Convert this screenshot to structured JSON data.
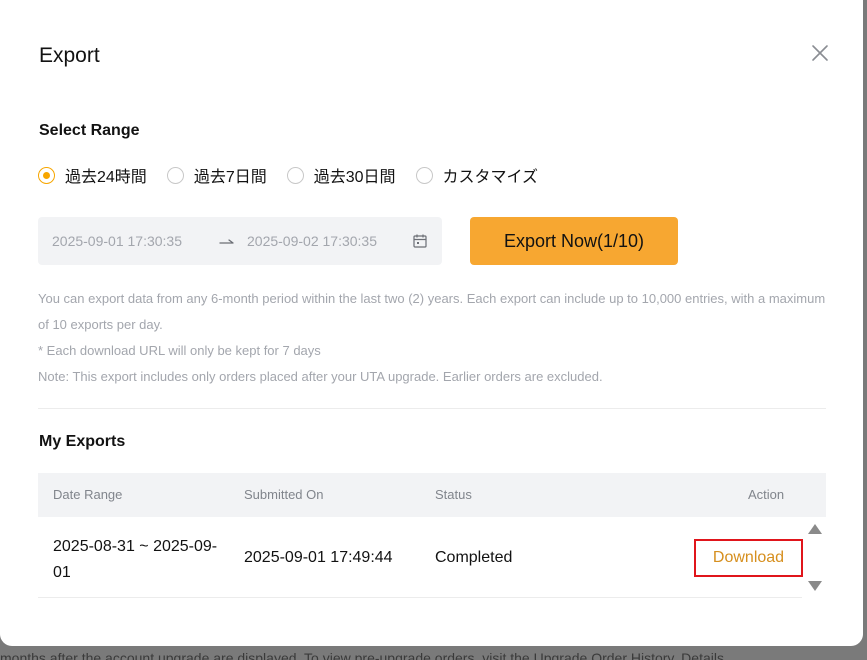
{
  "background_text": "months after the account upgrade are displayed. To view pre-upgrade orders, visit the Upgrade Order History. Details",
  "modal": {
    "title": "Export",
    "close_icon": "close-icon"
  },
  "select_range": {
    "title": "Select Range",
    "options": [
      {
        "label": "過去24時間",
        "checked": true
      },
      {
        "label": "過去7日間",
        "checked": false
      },
      {
        "label": "過去30日間",
        "checked": false
      },
      {
        "label": "カスタマイズ",
        "checked": false
      }
    ],
    "accent_color": "#f7a600"
  },
  "date_range": {
    "start": "2025-09-01 17:30:35",
    "end": "2025-09-02 17:30:35",
    "separator_icon": "arrow-right-icon",
    "calendar_icon": "calendar-icon"
  },
  "export_button": {
    "label": "Export Now(1/10)",
    "color": "#f7a731"
  },
  "notes": [
    "You can export data from any 6-month period within the last two (2) years. Each export can include up to 10,000 entries, with a maximum of 10 exports per day.",
    "* Each download URL will only be kept for 7 days",
    "Note: This export includes only orders placed after your UTA upgrade. Earlier orders are excluded."
  ],
  "my_exports": {
    "title": "My Exports",
    "columns": [
      "Date Range",
      "Submitted On",
      "Status",
      "Action"
    ],
    "rows": [
      {
        "date_range": "2025-08-31 ~ 2025-09-01",
        "submitted_on": "2025-09-01 17:49:44",
        "status": "Completed",
        "action": "Download"
      }
    ],
    "action_color": "#d68f1e",
    "highlight_color": "#e0151b"
  }
}
